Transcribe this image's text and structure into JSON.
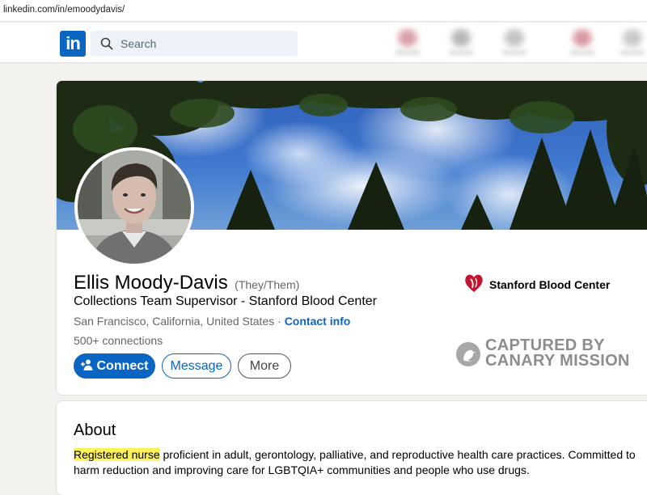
{
  "browser": {
    "url": "linkedin.com/in/emoodydavis/"
  },
  "nav": {
    "logo_text": "in",
    "search_placeholder": "Search",
    "brand_color": "#0a66c2"
  },
  "profile": {
    "name": "Ellis Moody-Davis",
    "pronouns": "(They/Them)",
    "headline": "Collections Team Supervisor - Stanford Blood Center",
    "location": "San Francisco, California, United States",
    "separator": "·",
    "contact_info_label": "Contact info",
    "connections": "500+ connections",
    "buttons": {
      "connect": "Connect",
      "message": "Message",
      "more": "More"
    },
    "company": "Stanford Blood Center"
  },
  "watermark": {
    "line1": "CAPTURED BY",
    "line2": "CANARY MISSION"
  },
  "about": {
    "title": "About",
    "highlight": "Registered nurse",
    "text": " proficient in adult, gerontology, palliative, and reproductive health care practices. Committed to harm reduction and improving care for LGBTQIA+ communities and people who use drugs."
  }
}
